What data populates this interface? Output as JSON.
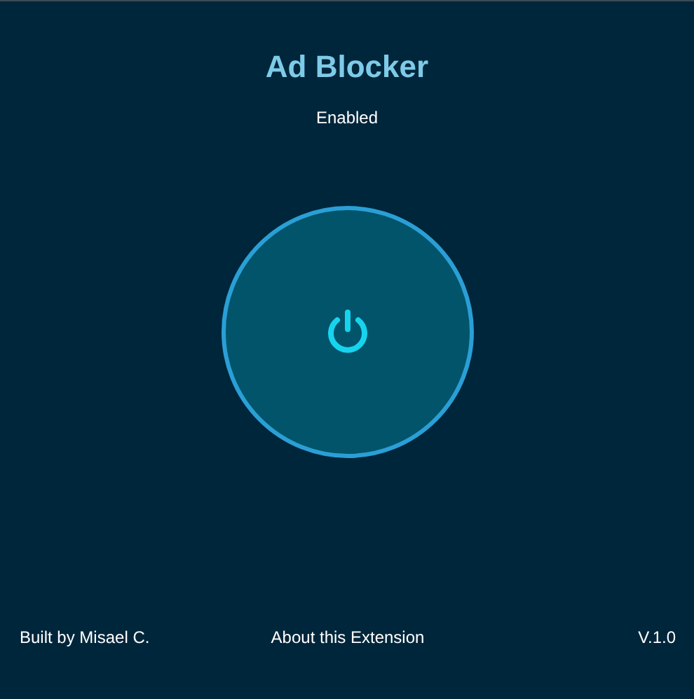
{
  "title": "Ad Blocker",
  "status": "Enabled",
  "power": {
    "on": true
  },
  "footer": {
    "author": "Built by Misael C.",
    "about_link": "About this Extension",
    "version": "V.1.0"
  }
}
